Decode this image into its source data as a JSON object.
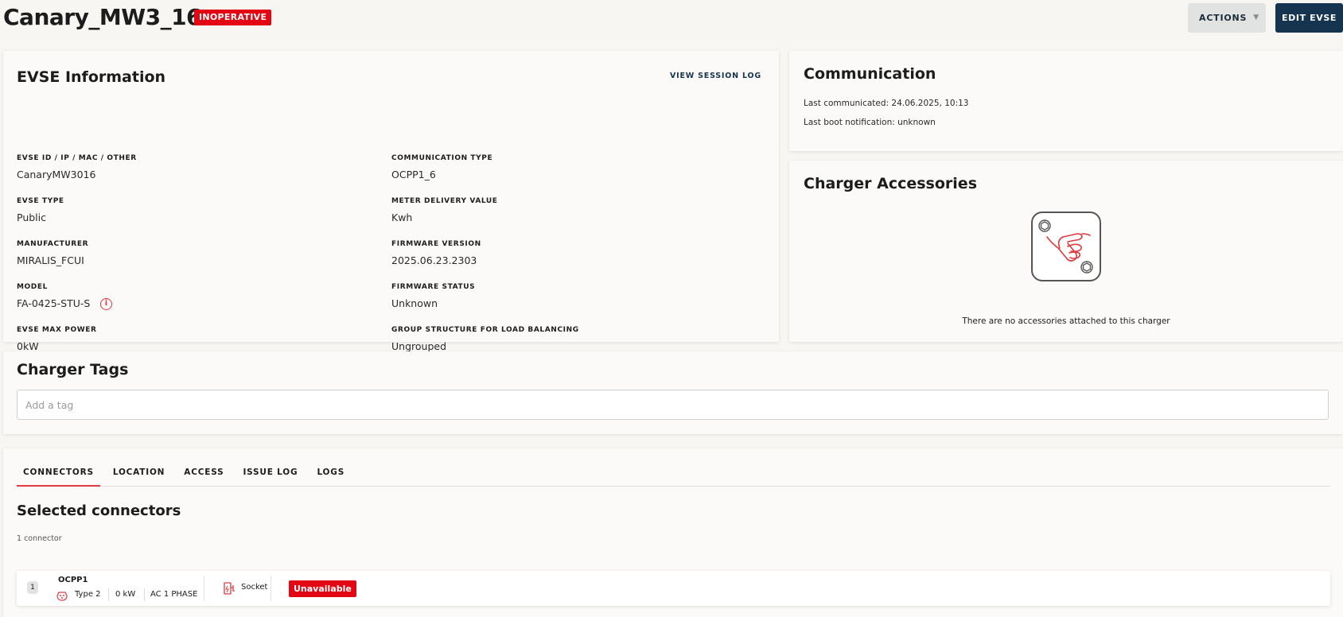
{
  "header": {
    "title": "Canary_MW3_16",
    "status": "INOPERATIVE",
    "actions_label": "ACTIONS",
    "edit_label": "EDIT EVSE"
  },
  "colors": {
    "accent": "#e30613",
    "primary_dark": "#14344f",
    "background": "#f7f6f3"
  },
  "evse_info": {
    "title": "EVSE Information",
    "view_session_log": "VIEW SESSION LOG",
    "fields": {
      "evse_id": {
        "label": "EVSE ID / IP / MAC / OTHER",
        "value": "CanaryMW3016"
      },
      "evse_type": {
        "label": "EVSE TYPE",
        "value": "Public"
      },
      "manufacturer": {
        "label": "MANUFACTURER",
        "value": "MIRALIS_FCUI"
      },
      "model": {
        "label": "MODEL",
        "value": "FA-0425-STU-S"
      },
      "max_power": {
        "label": "EVSE MAX POWER",
        "value": "0kW"
      },
      "comm_type": {
        "label": "COMMUNICATION TYPE",
        "value": "OCPP1_6"
      },
      "meter_value": {
        "label": "METER DELIVERY VALUE",
        "value": "Kwh"
      },
      "firmware_version": {
        "label": "FIRMWARE VERSION",
        "value": "2025.06.23.2303"
      },
      "firmware_status": {
        "label": "FIRMWARE STATUS",
        "value": "Unknown"
      },
      "group_structure": {
        "label": "GROUP STRUCTURE FOR LOAD BALANCING",
        "value": "Ungrouped"
      }
    },
    "model_info_icon": "info-icon"
  },
  "communication": {
    "title": "Communication",
    "last_communicated": "Last communicated: 24.06.2025, 10:13",
    "last_boot": "Last boot notification: unknown"
  },
  "accessories": {
    "title": "Charger Accessories",
    "illustration": "wrench-hand-icon",
    "empty_text": "There are no accessories attached to this charger"
  },
  "tags": {
    "title": "Charger Tags",
    "placeholder": "Add a tag",
    "value": ""
  },
  "connectors_section": {
    "tabs": [
      {
        "label": "CONNECTORS",
        "active": true
      },
      {
        "label": "LOCATION",
        "active": false
      },
      {
        "label": "ACCESS",
        "active": false
      },
      {
        "label": "ISSUE LOG",
        "active": false
      },
      {
        "label": "LOGS",
        "active": false
      }
    ],
    "title": "Selected connectors",
    "count": "1 connector",
    "connectors": [
      {
        "number": "1",
        "name": "OCPP1",
        "plug_type": "Type 2",
        "power": "0 kW",
        "phase": "AC 1 PHASE",
        "format": "Socket",
        "status": "Unavailable"
      }
    ]
  }
}
